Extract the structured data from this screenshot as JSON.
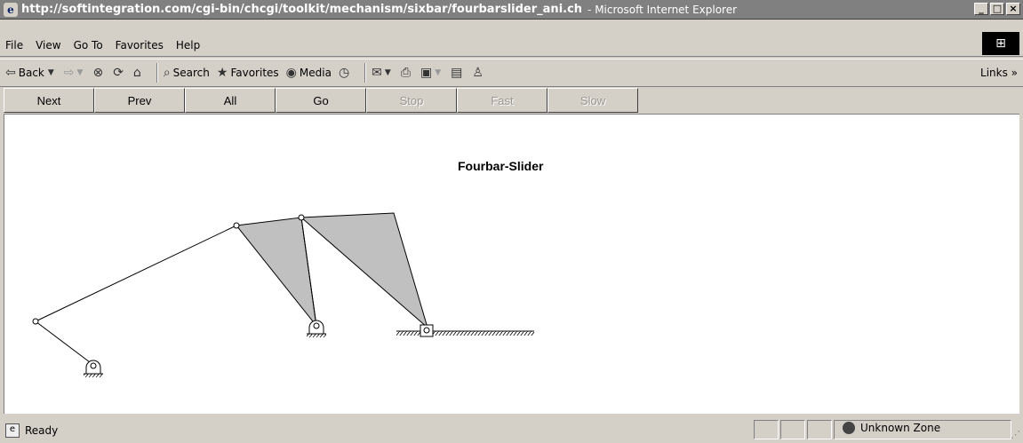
{
  "window": {
    "url": "http://softintegration.com/cgi-bin/chcgi/toolkit/mechanism/sixbar/fourbarslider_ani.ch",
    "app_suffix": "- Microsoft Internet Explorer",
    "btn_min": "_",
    "btn_max": "□",
    "btn_close": "×"
  },
  "menu": {
    "items": [
      "File",
      "View",
      "Go To",
      "Favorites",
      "Help"
    ]
  },
  "toolbar": {
    "back": "Back",
    "search": "Search",
    "favorites": "Favorites",
    "media": "Media",
    "links": "Links »"
  },
  "nav": {
    "next": "Next",
    "prev": "Prev",
    "all": "All",
    "go": "Go",
    "stop": "Stop",
    "fast": "Fast",
    "slow": "Slow"
  },
  "figure": {
    "title": "Fourbar-Slider"
  },
  "status": {
    "text": "Ready",
    "zone": "Unknown Zone"
  },
  "icons": {
    "app": "ie-icon",
    "back": "back-arrow-icon",
    "forward": "forward-arrow-icon",
    "stop": "stop-icon",
    "refresh": "refresh-icon",
    "home": "home-icon",
    "search": "search-icon",
    "favorites": "favorites-icon",
    "media": "media-icon",
    "history": "history-icon",
    "mail": "mail-icon",
    "print": "print-icon",
    "edit": "edit-icon",
    "discuss": "discuss-icon",
    "messenger": "messenger-icon"
  }
}
